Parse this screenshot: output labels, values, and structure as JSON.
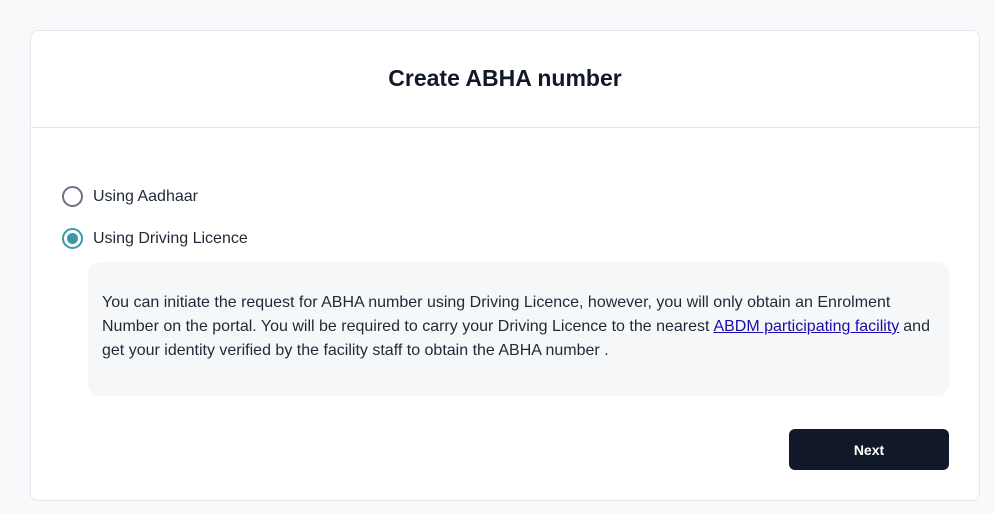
{
  "card": {
    "title": "Create ABHA number"
  },
  "options": [
    {
      "label": "Using Aadhaar",
      "selected": false
    },
    {
      "label": "Using Driving Licence",
      "selected": true
    }
  ],
  "info": {
    "text_before_link": "You can initiate the request for ABHA number using Driving Licence, however, you will only obtain an Enrolment Number on the portal. You will be required to carry your Driving Licence to the nearest",
    "link_text": "ABDM participating facility",
    "text_after_link": "and get your identity verified by the facility staff to obtain the ABHA number ."
  },
  "actions": {
    "next_label": "Next"
  },
  "colors": {
    "accent": "#3a9aa5",
    "button_bg": "#111827",
    "link": "#1a0dab",
    "info_bg": "#f6f7f9"
  }
}
